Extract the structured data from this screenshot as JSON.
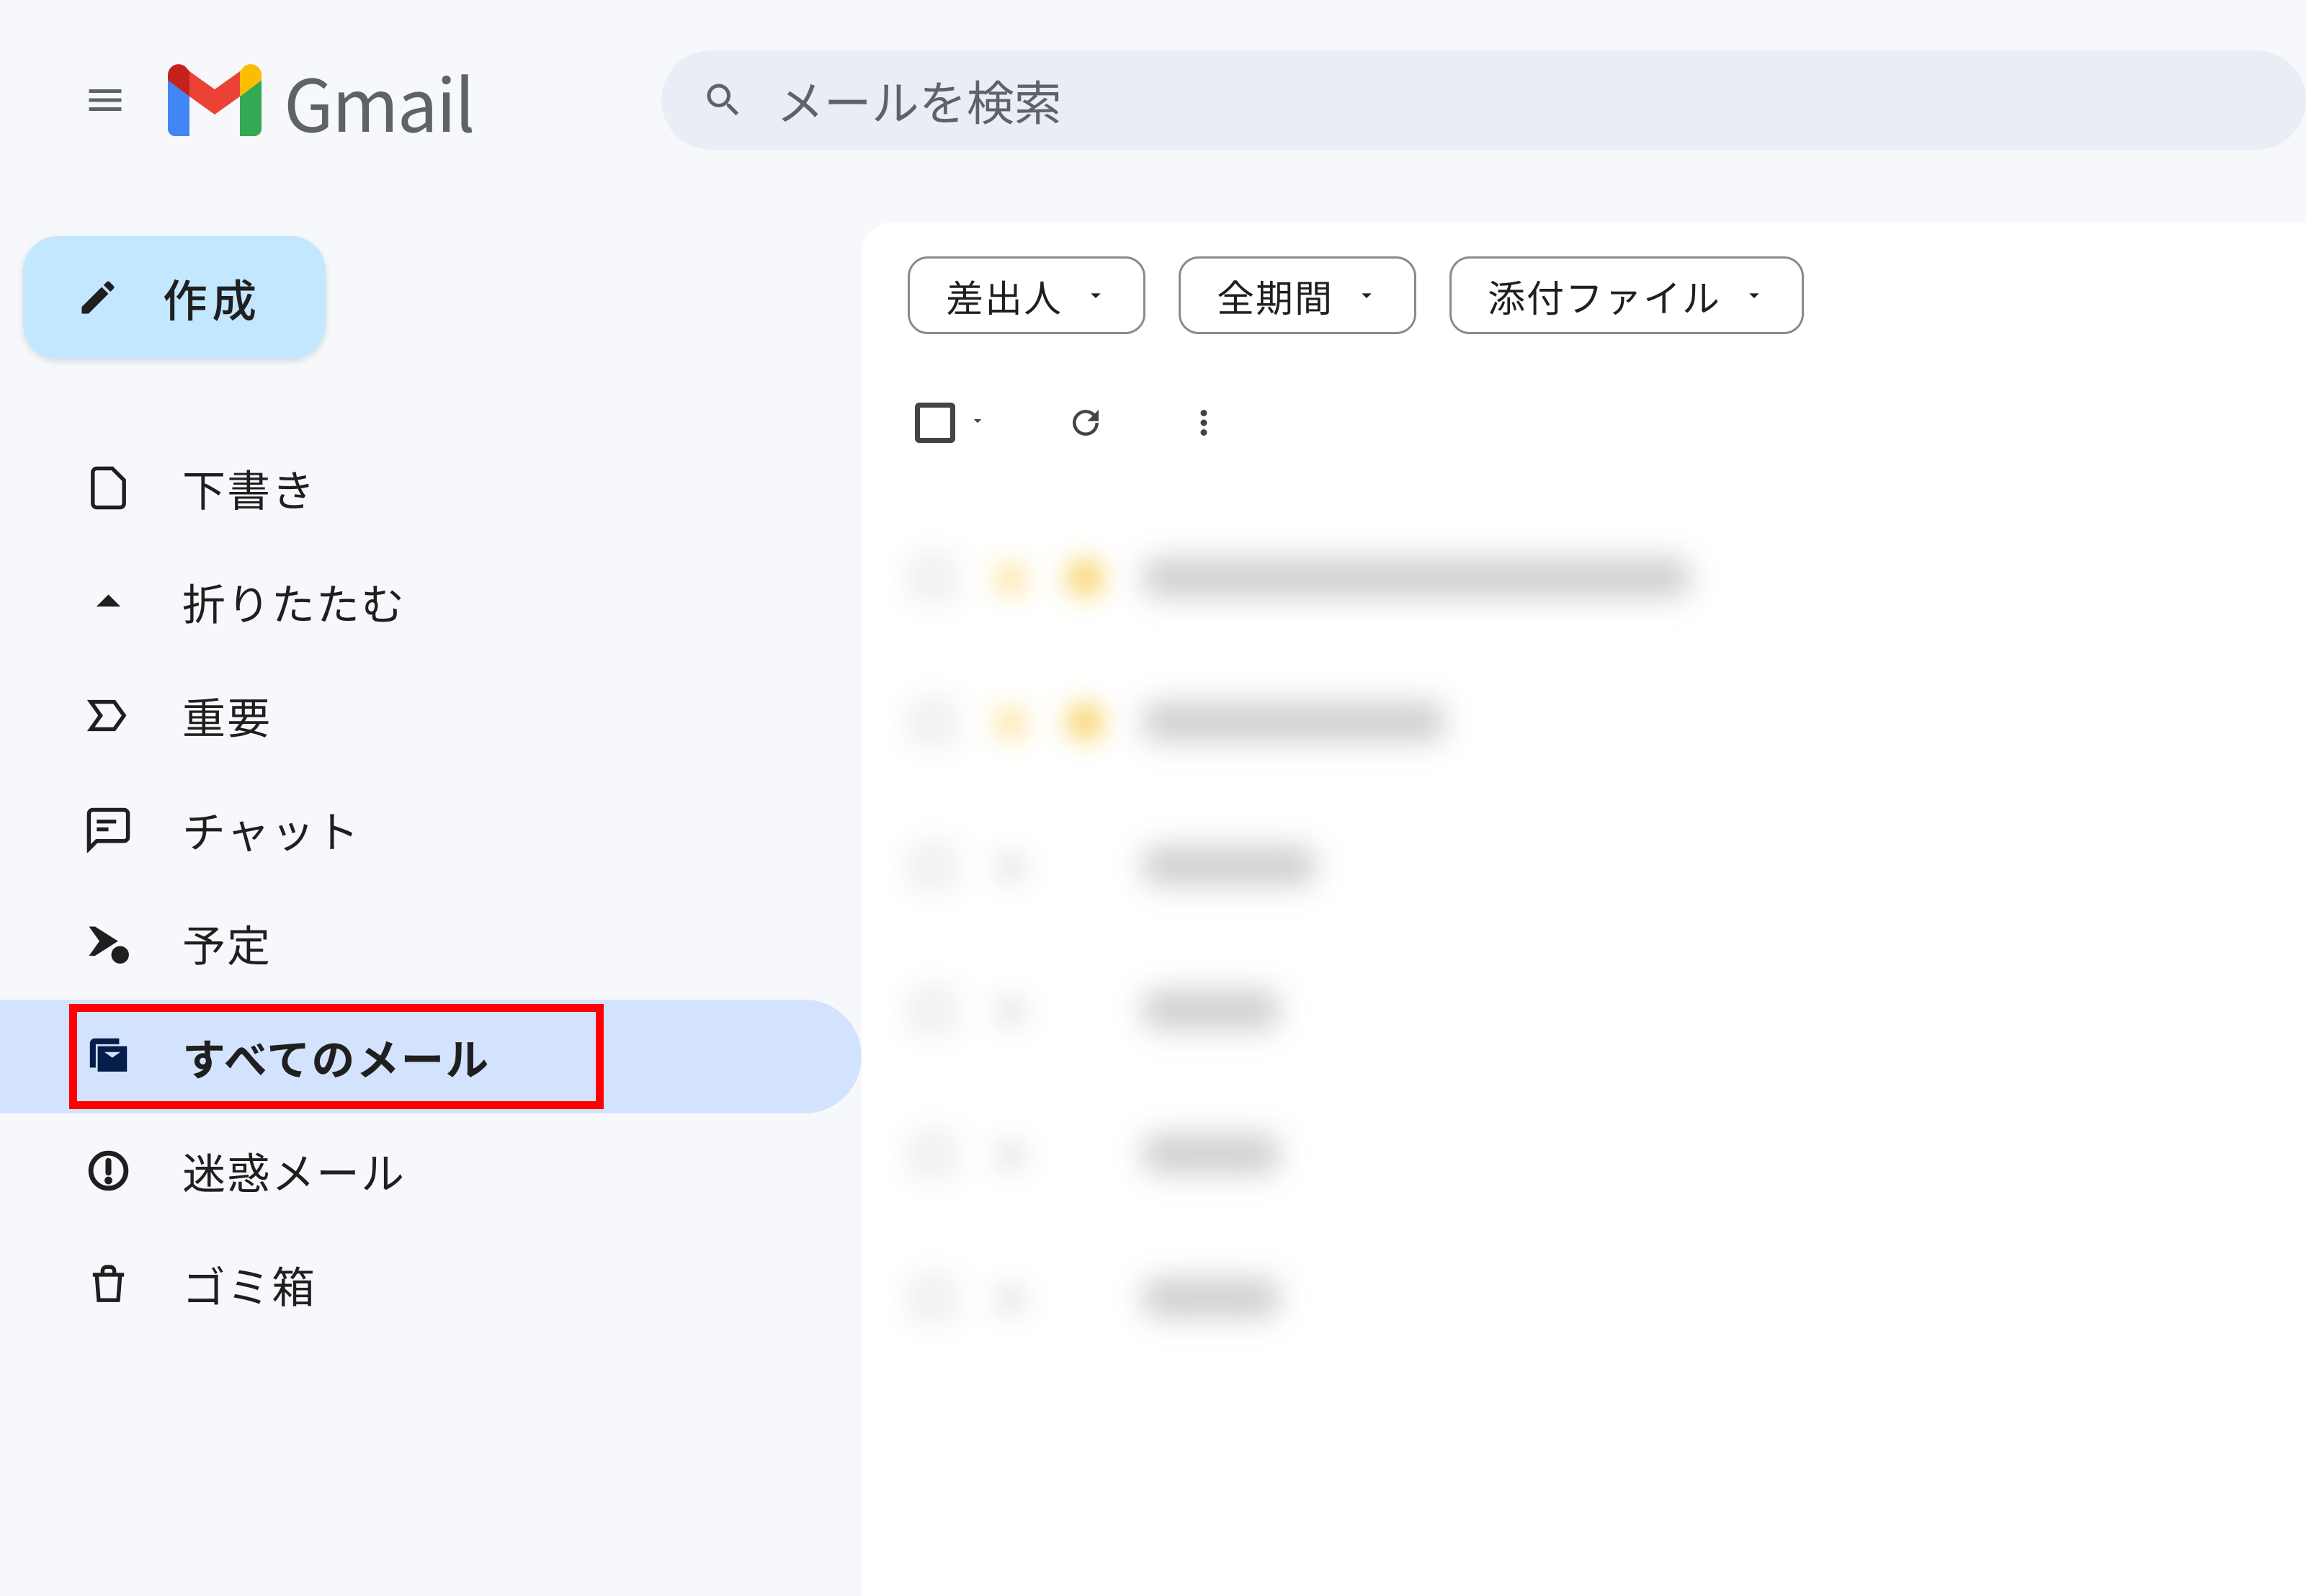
{
  "header": {
    "app_name": "Gmail",
    "search_placeholder": "メールを検索"
  },
  "compose": {
    "label": "作成"
  },
  "sidebar": {
    "items": [
      {
        "icon": "file-icon",
        "label": "下書き"
      },
      {
        "icon": "chevron-up-icon",
        "label": "折りたたむ"
      },
      {
        "icon": "important-icon",
        "label": "重要"
      },
      {
        "icon": "chat-icon",
        "label": "チャット"
      },
      {
        "icon": "schedule-icon",
        "label": "予定"
      },
      {
        "icon": "all-mail-icon",
        "label": "すべてのメール",
        "active": true,
        "highlight": true
      },
      {
        "icon": "spam-icon",
        "label": "迷惑メール"
      },
      {
        "icon": "trash-icon",
        "label": "ゴミ箱"
      }
    ]
  },
  "filters": {
    "chips": [
      {
        "label": "差出人"
      },
      {
        "label": "全期間"
      },
      {
        "label": "添付ファイル"
      }
    ]
  },
  "mail_rows": [
    {
      "starred": true,
      "label": true,
      "width_class": "w1"
    },
    {
      "starred": true,
      "label": true,
      "width_class": "w2"
    },
    {
      "starred": false,
      "label": false,
      "width_class": "w3"
    },
    {
      "starred": false,
      "label": false,
      "width_class": "w4"
    },
    {
      "starred": false,
      "label": false,
      "width_class": "w4"
    },
    {
      "starred": false,
      "label": false,
      "width_class": "w4"
    }
  ]
}
